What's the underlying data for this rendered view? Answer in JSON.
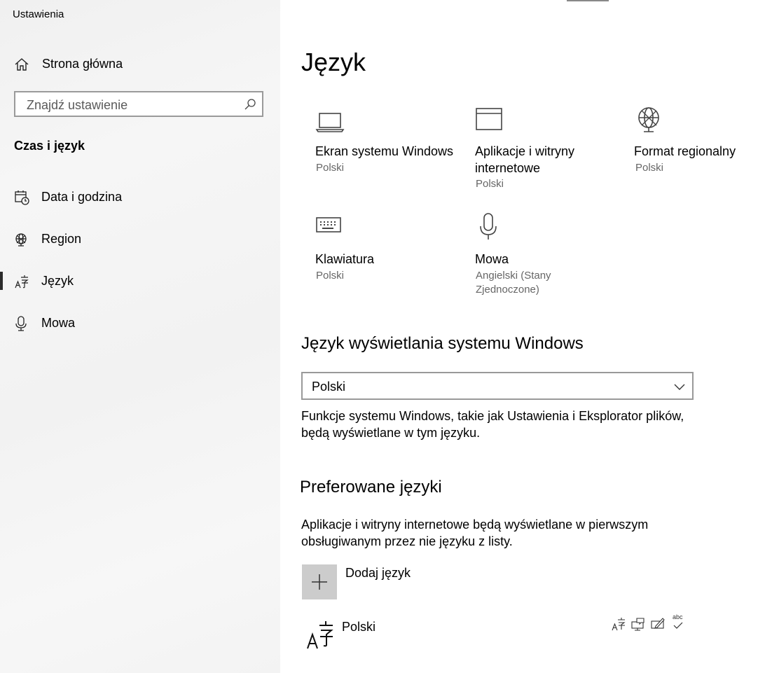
{
  "sidebar": {
    "app_title": "Ustawienia",
    "home_label": "Strona główna",
    "search_placeholder": "Znajdź ustawienie",
    "section_title": "Czas i język",
    "items": [
      {
        "label": "Data i godzina",
        "icon": "calendar-clock-icon"
      },
      {
        "label": "Region",
        "icon": "globe-icon"
      },
      {
        "label": "Język",
        "icon": "language-icon",
        "selected": true
      },
      {
        "label": "Mowa",
        "icon": "microphone-icon"
      }
    ]
  },
  "main": {
    "page_title": "Język",
    "tiles": [
      {
        "title": "Ekran systemu Windows",
        "subtitle": "Polski",
        "icon": "laptop-icon"
      },
      {
        "title": "Aplikacje i witryny internetowe",
        "subtitle": "Polski",
        "icon": "window-icon"
      },
      {
        "title": "Format regionalny",
        "subtitle": "Polski",
        "icon": "globe-icon"
      },
      {
        "title": "Klawiatura",
        "subtitle": "Polski",
        "icon": "keyboard-icon"
      },
      {
        "title": "Mowa",
        "subtitle": "Angielski (Stany Zjednoczone)",
        "icon": "microphone-icon"
      }
    ],
    "display_language": {
      "heading": "Język wyświetlania systemu Windows",
      "selected": "Polski",
      "description": "Funkcje systemu Windows, takie jak Ustawienia i Eksplorator plików, będą wyświetlane w tym języku."
    },
    "preferred": {
      "heading": "Preferowane języki",
      "description": "Aplikacje i witryny internetowe będą wyświetlane w pierwszym obsługiwanym przez nie języku z listy.",
      "add_label": "Dodaj język",
      "languages": [
        {
          "name": "Polski",
          "features": [
            "display-language-icon",
            "speech-icon",
            "handwriting-icon",
            "spellcheck-icon"
          ],
          "feature_text": "abc"
        }
      ]
    }
  }
}
